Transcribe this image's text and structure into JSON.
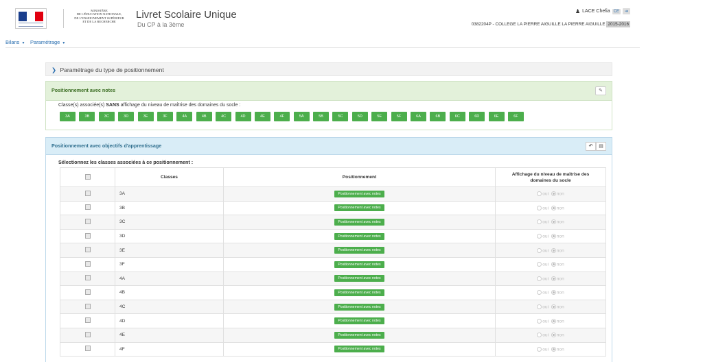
{
  "header": {
    "ministry_lines": [
      "MINISTÈRE",
      "DE L'ÉDUCATION NATIONALE,",
      "DE L'ENSEIGNEMENT SUPÉRIEUR",
      "ET DE LA RECHERCHE"
    ],
    "title": "Livret Scolaire Unique",
    "subtitle": "Du CP à la 3ème",
    "user_name": "LACE Chefia",
    "user_badge": "CE",
    "logout_icon": "logout-icon",
    "school": "0382204P - COLLEGE LA PIERRE AIGUILLE LA PIERRE AIGUILLE",
    "year": "2015-2016"
  },
  "nav": {
    "bilans": "Bilans",
    "parametrage": "Paramétrage"
  },
  "param_bar": {
    "label": "Paramétrage du type de positionnement"
  },
  "panel_notes": {
    "title": "Positionnement avec notes",
    "label_prefix": "Classe(s) associée(s)",
    "label_bold": "SANS",
    "label_suffix": "affichage du niveau de maîtrise des domaines du socle :",
    "classes": [
      "3A",
      "3B",
      "3C",
      "3D",
      "3E",
      "3F",
      "4A",
      "4B",
      "4C",
      "4D",
      "4E",
      "4F",
      "5A",
      "5B",
      "5C",
      "5D",
      "5E",
      "5F",
      "6A",
      "6B",
      "6C",
      "6D",
      "6E",
      "6F"
    ]
  },
  "panel_obj": {
    "title": "Positionnement avec objectifs d'apprentissage",
    "select_label": "Sélectionnez les classes associées à ce positionnement :",
    "col_classes": "Classes",
    "col_position": "Positionnement",
    "col_affichage_1": "Affichage du niveau de maîtrise des",
    "col_affichage_2": "domaines du socle",
    "position_label": "Positionnement avec notes",
    "oui": "oui",
    "non": "non",
    "rows": [
      "3A",
      "3B",
      "3C",
      "3D",
      "3E",
      "3F",
      "4A",
      "4B",
      "4C",
      "4D",
      "4E",
      "4F"
    ]
  },
  "colors": {
    "flag_blue": "#1a3e8c",
    "flag_white": "#ffffff",
    "flag_red": "#e1000f",
    "green": "#4cae4c",
    "link_blue": "#2a6fb0"
  }
}
